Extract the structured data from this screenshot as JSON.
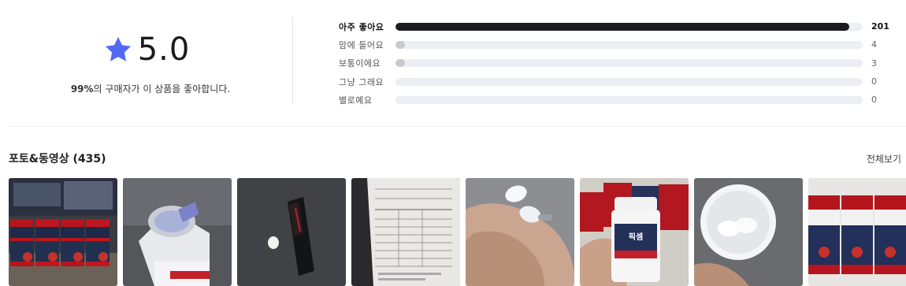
{
  "rating": {
    "score": "5.0",
    "percent": "99%",
    "caption_suffix": "의 구매자가 이 상품을 좋아합니다.",
    "star_color": "#5468f6"
  },
  "distribution": [
    {
      "label": "아주 좋아요",
      "count": "201",
      "fraction": 0.972
    },
    {
      "label": "맘에 들어요",
      "count": "4",
      "fraction": 0.02
    },
    {
      "label": "보통이에요",
      "count": "3",
      "fraction": 0.015
    },
    {
      "label": "그냥 그래요",
      "count": "0",
      "fraction": 0
    },
    {
      "label": "별로예요",
      "count": "0",
      "fraction": 0
    }
  ],
  "photos": {
    "title": "포토&동영상 (435)",
    "view_all": "전체보기",
    "brand_text": "픽셈"
  }
}
